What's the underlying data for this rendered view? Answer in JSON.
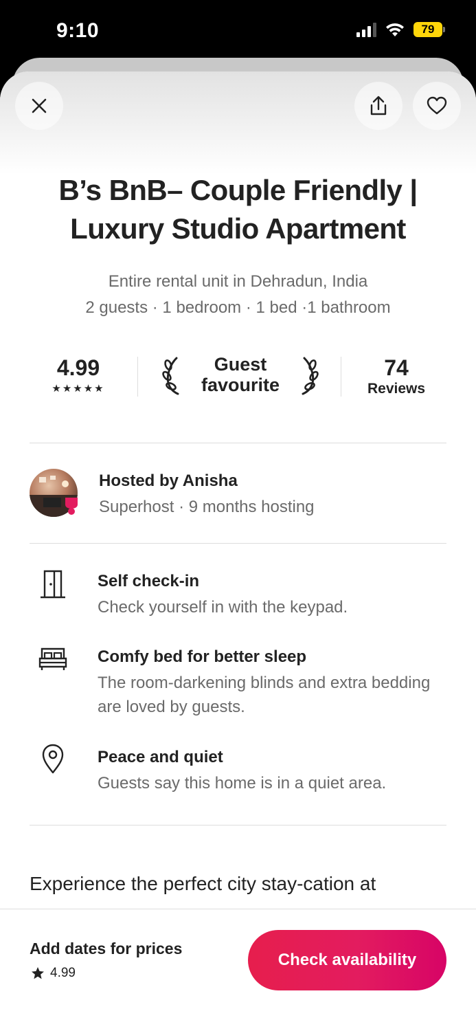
{
  "status_bar": {
    "time": "9:10",
    "battery": "79"
  },
  "listing": {
    "title": "B’s BnB– Couple Friendly | Luxury Studio Apartment",
    "location_line": "Entire rental unit in Dehradun, India",
    "details_line": "2 guests · 1 bedroom · 1 bed ·1 bathroom"
  },
  "stats": {
    "rating": "4.99",
    "stars": "★★★★★",
    "badge_line1": "Guest",
    "badge_line2": "favourite",
    "reviews_count": "74",
    "reviews_label": "Reviews"
  },
  "host": {
    "title": "Hosted by Anisha",
    "meta": "Superhost · 9 months hosting"
  },
  "features": [
    {
      "icon": "door-icon",
      "title": "Self check-in",
      "desc": "Check yourself in with the keypad."
    },
    {
      "icon": "bed-icon",
      "title": "Comfy bed for better sleep",
      "desc": "The room-darkening blinds and extra bedding are loved by guests."
    },
    {
      "icon": "map-pin-icon",
      "title": "Peace and quiet",
      "desc": "Guests say this home is in a quiet area."
    }
  ],
  "description": "Experience the perfect city stay-cation at",
  "footer": {
    "label": "Add dates for prices",
    "rating": "4.99",
    "cta": "Check availability"
  },
  "colors": {
    "brand": "#e31c5f",
    "superhost_badge": "#e31c5f"
  }
}
